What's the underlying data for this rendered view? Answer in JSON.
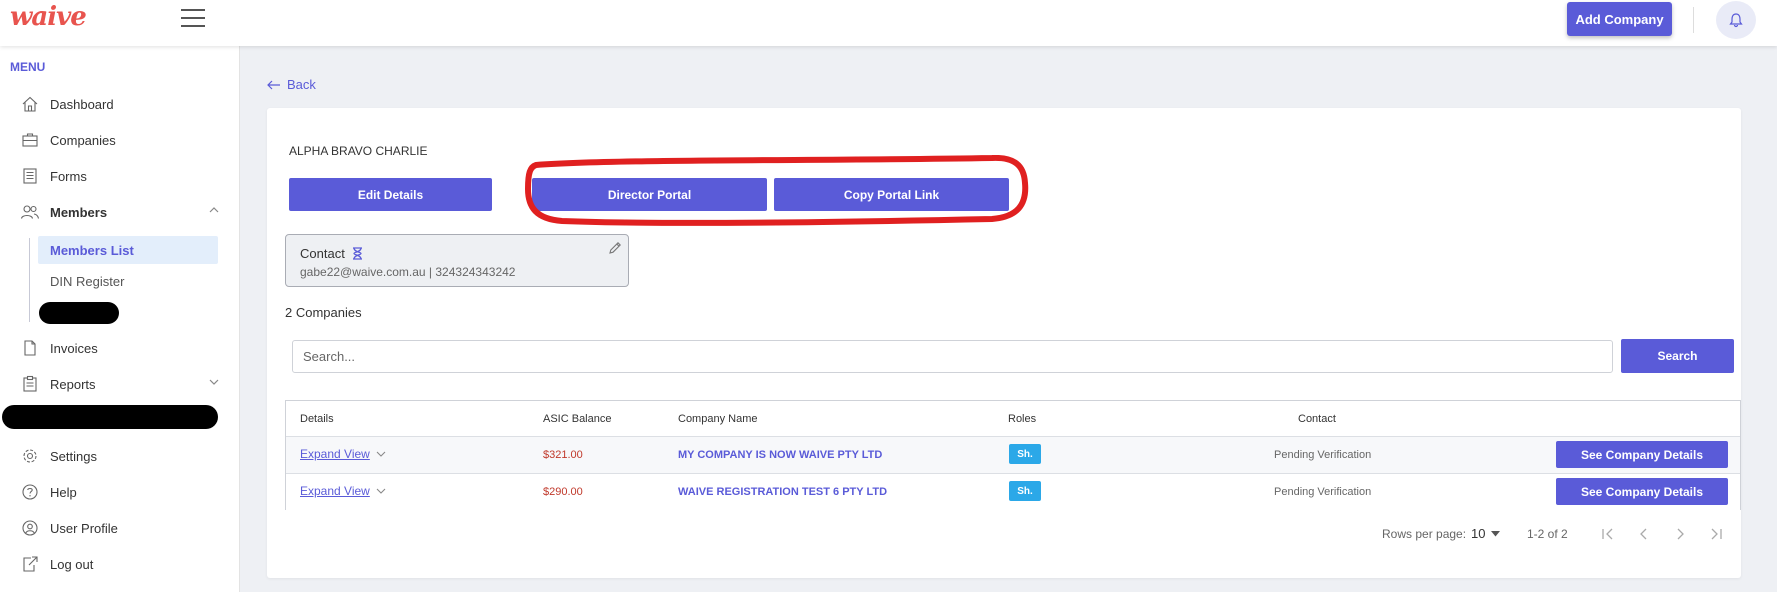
{
  "header": {
    "logo_text": "waive",
    "add_company_label": "Add Company"
  },
  "sidebar": {
    "menu_title": "MENU",
    "items": {
      "dashboard": "Dashboard",
      "companies": "Companies",
      "forms": "Forms",
      "members": "Members",
      "invoices": "Invoices",
      "reports": "Reports",
      "settings": "Settings",
      "help": "Help",
      "user_profile": "User Profile",
      "log_out": "Log out"
    },
    "members_sub": {
      "members_list": "Members List",
      "din_register": "DIN Register"
    }
  },
  "main": {
    "back_label": "Back",
    "member_name": "ALPHA BRAVO CHARLIE",
    "buttons": {
      "edit_details": "Edit Details",
      "director_portal": "Director Portal",
      "copy_portal_link": "Copy Portal Link"
    },
    "contact": {
      "label": "Contact",
      "value": "gabe22@waive.com.au | 324324343242"
    },
    "companies_count": "2 Companies",
    "search": {
      "placeholder": "Search...",
      "button_label": "Search"
    },
    "table": {
      "headers": {
        "details": "Details",
        "asic_balance": "ASIC Balance",
        "company_name": "Company Name",
        "roles": "Roles",
        "contact": "Contact"
      },
      "rows": [
        {
          "expand_label": "Expand View",
          "asic_balance": "$321.00",
          "company_name": "MY COMPANY IS NOW WAIVE PTY LTD",
          "role": "Sh.",
          "contact_status": "Pending Verification",
          "action_label": "See Company Details"
        },
        {
          "expand_label": "Expand View",
          "asic_balance": "$290.00",
          "company_name": "WAIVE REGISTRATION TEST 6 PTY LTD",
          "role": "Sh.",
          "contact_status": "Pending Verification",
          "action_label": "See Company Details"
        }
      ]
    },
    "pagination": {
      "rows_per_page_label": "Rows per page:",
      "rows_per_page_value": "10",
      "range": "1-2 of 2"
    }
  },
  "colors": {
    "brand": "#5a5bd8",
    "logo": "#e8544e",
    "role_badge": "#2ba8e8",
    "balance": "#c0392b",
    "annotation": "#e02020"
  }
}
